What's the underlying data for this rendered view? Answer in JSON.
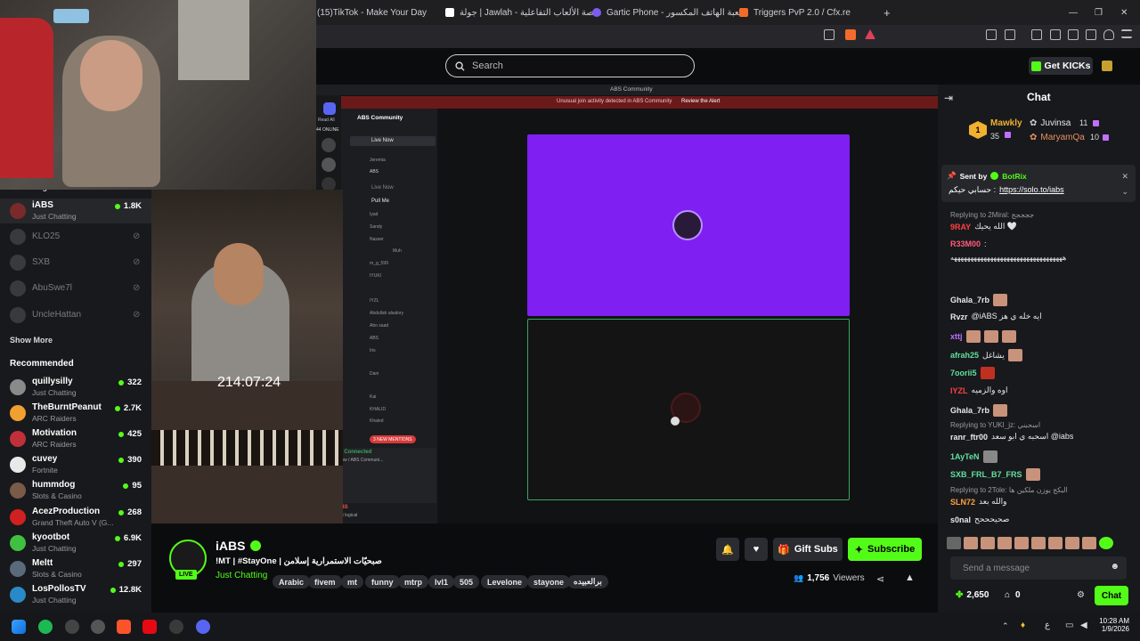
{
  "browser": {
    "tabs": [
      {
        "label": "(15)TikTok - Make Your Day",
        "color": "#25f4ee"
      },
      {
        "label": "جولة | Jawlah - منصة الألعاب التفاعلية",
        "color": "#ffffff"
      },
      {
        "label": "Gartic Phone - لعبة الهاتف المكسور",
        "color": "#7b5cf0"
      },
      {
        "label": "Triggers PvP 2.0 / Cfx.re",
        "color": "#f26b2c"
      }
    ],
    "new_tab": "+",
    "window_controls": [
      "—",
      "❐",
      "✕"
    ]
  },
  "header": {
    "search_placeholder": "Search",
    "get_kicks_label": "Get KICKs"
  },
  "sidebar": {
    "following_label": "Following",
    "following": [
      {
        "name": "iABS",
        "category": "Just Chatting",
        "viewers": "1.8K",
        "live": true
      },
      {
        "name": "KLO25",
        "live": false
      },
      {
        "name": "SXB",
        "live": false
      },
      {
        "name": "AbuSwe7l",
        "live": false
      },
      {
        "name": "UncleHattan",
        "live": false
      }
    ],
    "show_more": "Show More",
    "recommended_label": "Recommended",
    "recommended": [
      {
        "name": "quillysilly",
        "category": "Just Chatting",
        "viewers": "322",
        "color": "#8a8a8a"
      },
      {
        "name": "TheBurntPeanut",
        "category": "ARC Raiders",
        "viewers": "2.7K",
        "color": "#f0a030"
      },
      {
        "name": "Motivation",
        "category": "ARC Raiders",
        "viewers": "425",
        "color": "#c0303a"
      },
      {
        "name": "cuvey",
        "category": "Fortnite",
        "viewers": "390",
        "color": "#e8e8e8"
      },
      {
        "name": "hummdog",
        "category": "Slots & Casino",
        "viewers": "95",
        "color": "#7a5a48"
      },
      {
        "name": "AcezProduction",
        "category": "Grand Theft Auto V (G...",
        "viewers": "268",
        "color": "#d02020"
      },
      {
        "name": "kyootbot",
        "category": "Just Chatting",
        "viewers": "6.9K",
        "color": "#40c040"
      },
      {
        "name": "Meltt",
        "category": "Slots & Casino",
        "viewers": "297",
        "color": "#5a6a7a"
      },
      {
        "name": "LosPollosTV",
        "category": "Just Chatting",
        "viewers": "12.8K",
        "color": "#2a8ac8"
      }
    ]
  },
  "video": {
    "timer": "214:07:24",
    "discord": {
      "title": "ABS Community",
      "alert": "Unusual join activity detected in ABS Community",
      "alert_action": "Review the Alert",
      "server_name": "ABS Community",
      "online": "44 ONLINE",
      "read_all": "Read All",
      "channels": [
        "Live Now",
        "Live Now",
        "Pull Me"
      ],
      "members": [
        "Jeremia",
        "ABS",
        "Sandy",
        "Iyad",
        "Nasser",
        "Muh",
        "m_g_599",
        "IYUKI",
        "IYZL",
        "Abdullah alsalory",
        "Abo saad",
        "ABS",
        "Iris",
        "Dani",
        "Kai",
        "KHALID",
        "Khaled"
      ],
      "mentions_badge": "3 NEW MENTIONS",
      "voice_connected": "Voice Connected",
      "voice_channel": "Live Now / ABS Communi...",
      "user_name": "ABS",
      "user_status": "Not logical"
    }
  },
  "stream": {
    "channel_name": "iABS",
    "title": "!MT | #StayOne | صبحيّات الاستمرارية إسلامن",
    "category": "Just Chatting",
    "tags": [
      "Arabic",
      "fivem",
      "mt",
      "funny",
      "mtrp",
      "lvl1",
      "505",
      "Levelone",
      "stayone",
      "برالعبيده"
    ],
    "live_badge": "LIVE",
    "gift_subs": "Gift Subs",
    "subscribe": "Subscribe",
    "viewers": "1,756",
    "viewers_label": "Viewers"
  },
  "chat": {
    "title": "Chat",
    "leaders": [
      {
        "rank": "1",
        "name": "Mawkly",
        "score": "35"
      },
      {
        "name": "Juvinsa",
        "score": "11"
      },
      {
        "name": "MaryamQa",
        "score": "10"
      }
    ],
    "pinned_sender": "BotRix",
    "pinned_prefix": "Sent by",
    "pinned_text": "حسابي حيكم :",
    "pinned_link": "https://solo.to/iabs",
    "messages": [
      {
        "reply": "Replying to 2Miral: ججججج",
        "user": "9RAY",
        "text": "الله يحيك 🤍",
        "color": "#ff4040"
      },
      {
        "user": "R33M00",
        "text": "",
        "color": "#ff5a7a"
      },
      {
        "text": "ههههههههههههههههههههههههههههههههههه",
        "user": "",
        "color": "#ffffff"
      },
      {
        "user": "Ghala_7rb",
        "text": "",
        "color": "#e8e8ea"
      },
      {
        "user": "Rvzr",
        "text": "@iABS ايه خله ي هز",
        "color": "#e8e8ea"
      },
      {
        "user": "xttj",
        "text": "",
        "color": "#c070ff"
      },
      {
        "user": "afrah25",
        "text": "يشاغل",
        "color": "#60e0a0"
      },
      {
        "user": "7oorii5",
        "text": "",
        "color": "#60e0a0"
      },
      {
        "user": "IYZL",
        "text": "اوه والزميه",
        "color": "#ff4040"
      },
      {
        "user": "Ghala_7rb",
        "text": "",
        "color": "#e8e8ea"
      },
      {
        "reply": "Replying to YUKI_jz: اسحبني",
        "user": "ranr_ftr00",
        "text": "اسحبه ي ابو سعد @iabs",
        "color": "#e8e8ea"
      },
      {
        "user": "1AyTeN",
        "text": "",
        "color": "#60e0a0"
      },
      {
        "user": "SXB_FRL_B7_FRS",
        "text": "",
        "color": "#60e0a0"
      },
      {
        "reply": "Replying to 2Tole: البكج يوزن ملكين ها",
        "user": "SLN72",
        "text": "والله بعد",
        "color": "#ffa040"
      },
      {
        "user": "s0nal",
        "text": "صحيحححح",
        "color": "#e8e8ea"
      }
    ],
    "input_placeholder": "Send a message",
    "points": "2,650",
    "other_count": "0",
    "chat_button": "Chat"
  },
  "taskbar": {
    "time": "10:28 AM",
    "date": "1/9/2026",
    "lang": "ع"
  }
}
